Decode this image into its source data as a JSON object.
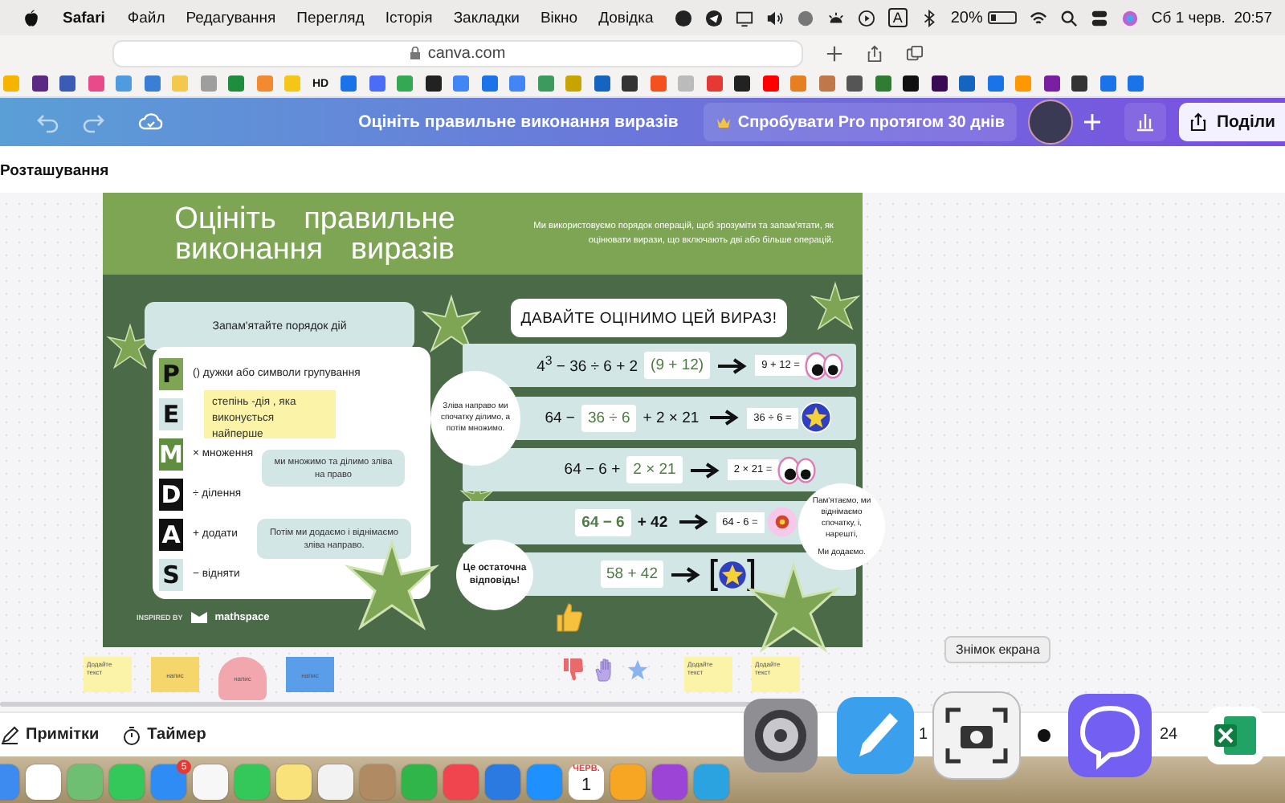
{
  "menubar": {
    "app": "Safari",
    "menus": [
      "Файл",
      "Редагування",
      "Перегляд",
      "Історія",
      "Закладки",
      "Вікно",
      "Довідка"
    ],
    "input_source": "A",
    "battery": {
      "text": "20%",
      "level": 0.2
    },
    "clock": "Сб 1 черв.  20:57"
  },
  "browser": {
    "url": "canva.com"
  },
  "bookmarks": [
    {
      "kind": "icon",
      "color": "#f4b400"
    },
    {
      "kind": "icon",
      "color": "#5b2a86"
    },
    {
      "kind": "icon",
      "color": "#3b5bb5"
    },
    {
      "kind": "icon",
      "color": "#e84a8a"
    },
    {
      "kind": "icon",
      "color": "#4f9be0"
    },
    {
      "kind": "icon",
      "color": "#3a7fd5"
    },
    {
      "kind": "icon",
      "color": "#f2c94c"
    },
    {
      "kind": "icon",
      "color": "#9e9e9e"
    },
    {
      "kind": "icon",
      "color": "#1e8e3e"
    },
    {
      "kind": "icon",
      "color": "#f28b30"
    },
    {
      "kind": "icon",
      "color": "#f5c518"
    },
    {
      "kind": "text",
      "label": "HD"
    },
    {
      "kind": "icon",
      "color": "#1a73e8"
    },
    {
      "kind": "icon",
      "color": "#4a6cf7"
    },
    {
      "kind": "icon",
      "color": "#34a853"
    },
    {
      "kind": "icon",
      "color": "#222222"
    },
    {
      "kind": "icon",
      "color": "#4285f4"
    },
    {
      "kind": "icon",
      "color": "#1a73e8"
    },
    {
      "kind": "icon",
      "color": "#4285f4"
    },
    {
      "kind": "icon",
      "color": "#3c9a5f"
    },
    {
      "kind": "icon",
      "color": "#c8a400"
    },
    {
      "kind": "icon",
      "color": "#1565c0"
    },
    {
      "kind": "icon",
      "color": "#333333"
    },
    {
      "kind": "icon",
      "color": "#f4511e"
    },
    {
      "kind": "icon",
      "color": "#bbbbbb"
    },
    {
      "kind": "icon",
      "color": "#e53935"
    },
    {
      "kind": "icon",
      "color": "#222222"
    },
    {
      "kind": "icon",
      "color": "#ff0000"
    },
    {
      "kind": "icon",
      "color": "#e67e22"
    },
    {
      "kind": "icon",
      "color": "#c0784a"
    },
    {
      "kind": "icon",
      "color": "#555555"
    },
    {
      "kind": "icon",
      "color": "#2e7d32"
    },
    {
      "kind": "icon",
      "color": "#111111"
    },
    {
      "kind": "icon",
      "color": "#3b0a57"
    },
    {
      "kind": "icon",
      "color": "#1565c0"
    },
    {
      "kind": "icon",
      "color": "#1a73e8"
    },
    {
      "kind": "icon",
      "color": "#ff9800"
    },
    {
      "kind": "icon",
      "color": "#7b1fa2"
    },
    {
      "kind": "icon",
      "color": "#333333"
    },
    {
      "kind": "icon",
      "color": "#1a73e8"
    },
    {
      "kind": "icon",
      "color": "#1a73e8"
    }
  ],
  "editor": {
    "title": "Оцініть правильне виконання виразів",
    "pro_button": "Спробувати Pro протягом 30 днів",
    "share_button": "Поділи"
  },
  "panel_label": "Розташування",
  "slide": {
    "title": "Оцініть правильне виконання виразів",
    "subtitle": "Ми використовуємо порядок операцій, щоб зрозуміти та запам'ятати, як оцінювати вирази, що включають дві або більше операцій.",
    "card_heading": "Запам'ятайте порядок дій",
    "letters": [
      {
        "letter": "P",
        "color": "#7da553",
        "text": "() дужки або символи групування"
      },
      {
        "letter": "E",
        "color": "#d3e6e6"
      },
      {
        "letter": "M",
        "color": "#5f8f3e",
        "text": "× множення"
      },
      {
        "letter": "D",
        "color": "#111111",
        "text": "÷ ділення"
      },
      {
        "letter": "A",
        "color": "#111111",
        "text": "+ додати"
      },
      {
        "letter": "S",
        "color": "#d3e6e6",
        "text": "− відняти"
      }
    ],
    "notes": [
      {
        "kind": "sticky",
        "text": "степінь -дія , яка виконується найперше"
      },
      {
        "kind": "bubble",
        "text": "ми множимо та ділимо зліва на право"
      },
      {
        "kind": "bubble",
        "text": "Потім ми додаємо і віднімаємо зліва направо."
      }
    ],
    "credit": {
      "label": "INSPIRED BY",
      "brand": "mathspace"
    },
    "left_bubble": "Зліва направо ми спочатку ділимо, а потім множимо.",
    "heading": "ДАВАЙТЕ ОЦІНИМО ЦЕЙ ВИРАЗ!",
    "steps": [
      {
        "bold": false,
        "parts": [
          {
            "text": "4$^{3}$ − 36 ÷ 6 + 2",
            "highlight": false
          },
          {
            "text": "(9 + 12)",
            "highlight": true
          }
        ],
        "result": "9 + 12 =",
        "sticker": {
          "kind": "eyes"
        }
      },
      {
        "bold": false,
        "parts": [
          {
            "text": "64 −",
            "highlight": false
          },
          {
            "text": "36 ÷ 6",
            "highlight": true
          },
          {
            "text": "+ 2 × 21",
            "highlight": false
          }
        ],
        "result": "36 ÷ 6 =",
        "sticker": {
          "kind": "star-badge"
        }
      },
      {
        "bold": false,
        "parts": [
          {
            "text": "64 − 6 +",
            "highlight": false
          },
          {
            "text": "2 × 21",
            "highlight": true
          }
        ],
        "result": "2 × 21 =",
        "sticker": {
          "kind": "eyes"
        }
      },
      {
        "bold": true,
        "parts": [
          {
            "text": "64 − 6",
            "highlight": true
          },
          {
            "text": "+ 42",
            "highlight": false
          }
        ],
        "result": "64 - 6 =",
        "sticker": {
          "kind": "flower"
        }
      },
      {
        "bold": false,
        "note": "Це остаточна відповідь!",
        "parts": [
          {
            "text": "58 + 42",
            "highlight": true
          }
        ],
        "sticker": {
          "kind": "framed-star"
        }
      }
    ],
    "right_bubble": [
      "Пам'ятаємо, ми віднімаємо спочатку, і, нарешті,",
      "Ми додаємо."
    ]
  },
  "stickies": [
    {
      "kind": "note",
      "color": "#fbf3a8",
      "text": "Додайте текст"
    },
    {
      "kind": "note",
      "color": "#f5d66b",
      "text": "напис"
    },
    {
      "kind": "circle",
      "color": "#f2a7ae",
      "text": "напис"
    },
    {
      "kind": "note",
      "color": "#5a9de8",
      "text": "напис"
    },
    {
      "kind": "reactions"
    },
    {
      "kind": "note",
      "color": "#fbf3a8",
      "text": "Додайте текст"
    },
    {
      "kind": "note",
      "color": "#fbf3a8",
      "text": "Додайте текст"
    }
  ],
  "bottom_bar": {
    "notes": "Примітки",
    "timer": "Таймер",
    "page": "1",
    "zoom": "24"
  },
  "tooltip": "Знімок екрана",
  "dock": [
    {
      "kind": "app",
      "color": "#3d8bf0"
    },
    {
      "kind": "app",
      "color": "#ffffff"
    },
    {
      "kind": "app",
      "color": "#6fbf73"
    },
    {
      "kind": "app",
      "color": "#34c759"
    },
    {
      "kind": "app",
      "color": "#2f8cf5",
      "badge": "5"
    },
    {
      "kind": "app",
      "color": "#f7f7f7"
    },
    {
      "kind": "app",
      "color": "#34c759"
    },
    {
      "kind": "app",
      "color": "#f9e27a"
    },
    {
      "kind": "app",
      "color": "#f2f2f2"
    },
    {
      "kind": "app",
      "color": "#b08a63"
    },
    {
      "kind": "app",
      "color": "#2fb54a"
    },
    {
      "kind": "app",
      "color": "#f0444f"
    },
    {
      "kind": "app",
      "color": "#2a7ae2"
    },
    {
      "kind": "app",
      "color": "#1e90ff"
    },
    {
      "kind": "calendar",
      "month": "ЧЕРВ.",
      "day": "1"
    },
    {
      "kind": "app",
      "color": "#f6a623"
    },
    {
      "kind": "app",
      "color": "#9b44d6"
    },
    {
      "kind": "app",
      "color": "#2aa3e0"
    }
  ]
}
